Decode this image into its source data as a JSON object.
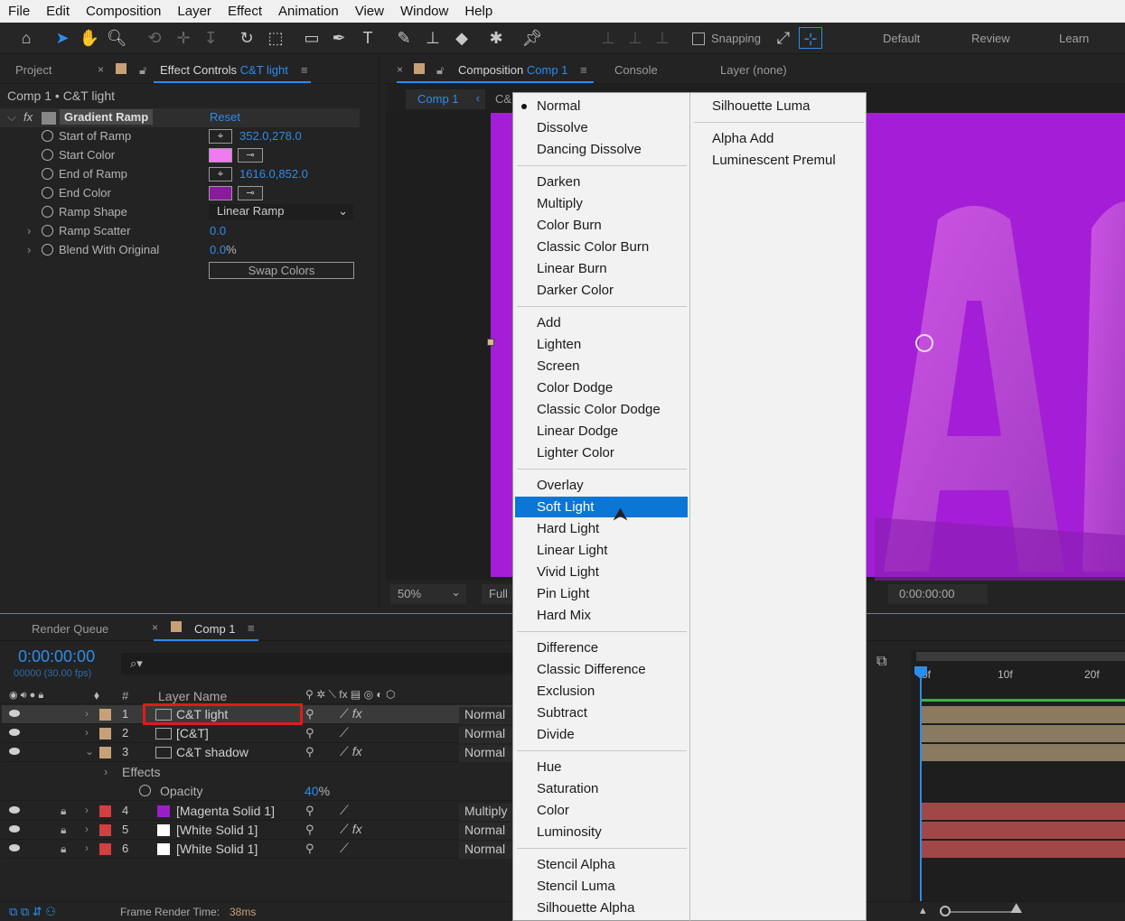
{
  "menubar": [
    "File",
    "Edit",
    "Composition",
    "Layer",
    "Effect",
    "Animation",
    "View",
    "Window",
    "Help"
  ],
  "toolbar": {
    "snapping_label": "Snapping",
    "workspaces": [
      "Default",
      "Review",
      "Learn"
    ]
  },
  "project_tab": "Project",
  "effect_controls": {
    "tab_label": "Effect Controls",
    "tab_layer": "C&T light",
    "breadcrumb": "Comp 1 • C&T light",
    "effect_name": "Gradient Ramp",
    "reset_label": "Reset",
    "properties": [
      {
        "label": "Start of Ramp",
        "value": "352.0,278.0"
      },
      {
        "label": "Start Color",
        "value": ""
      },
      {
        "label": "End of Ramp",
        "value": "1616.0,852.0"
      },
      {
        "label": "End Color",
        "value": ""
      },
      {
        "label": "Ramp Shape",
        "value": "Linear Ramp"
      },
      {
        "label": "Ramp Scatter",
        "value": "0.0"
      },
      {
        "label": "Blend With Original",
        "value": "0.0",
        "unit": "%"
      }
    ],
    "start_color": "#f07af0",
    "end_color": "#8a1a9e",
    "swap_colors_label": "Swap Colors"
  },
  "composition": {
    "tab_label": "Composition",
    "tab_comp": "Comp 1",
    "console_tab": "Console",
    "layer_tab": "Layer (none)",
    "subtab": "Comp 1",
    "subtab2": "C&",
    "zoom": "50%",
    "resolution": "Full",
    "timecode": "0:00:00:00",
    "bg_color": "#a31ed6",
    "letter": "AB"
  },
  "blend_menu": {
    "groups": [
      [
        "Normal",
        "Dissolve",
        "Dancing Dissolve"
      ],
      [
        "Darken",
        "Multiply",
        "Color Burn",
        "Classic Color Burn",
        "Linear Burn",
        "Darker Color"
      ],
      [
        "Add",
        "Lighten",
        "Screen",
        "Color Dodge",
        "Classic Color Dodge",
        "Linear Dodge",
        "Lighter Color"
      ],
      [
        "Overlay",
        "Soft Light",
        "Hard Light",
        "Linear Light",
        "Vivid Light",
        "Pin Light",
        "Hard Mix"
      ],
      [
        "Difference",
        "Classic Difference",
        "Exclusion",
        "Subtract",
        "Divide"
      ],
      [
        "Hue",
        "Saturation",
        "Color",
        "Luminosity"
      ],
      [
        "Stencil Alpha",
        "Stencil Luma",
        "Silhouette Alpha"
      ]
    ],
    "column2": [
      [
        "Silhouette Luma"
      ],
      [
        "Alpha Add",
        "Luminescent Premul"
      ]
    ],
    "checked": "Normal",
    "highlighted": "Soft Light"
  },
  "timeline": {
    "render_queue_tab": "Render Queue",
    "comp_tab": "Comp 1",
    "timecode": "0:00:00:00",
    "fps": "00000 (30.00 fps)",
    "col_hash": "#",
    "col_layer_name": "Layer Name",
    "layers": [
      {
        "num": "1",
        "name": "C&T light",
        "mode": "Normal",
        "color": "#c8a078",
        "fx": true
      },
      {
        "num": "2",
        "name": "[C&T]",
        "mode": "Normal",
        "color": "#c8a078",
        "fx": false
      },
      {
        "num": "3",
        "name": "C&T shadow",
        "mode": "Normal",
        "color": "#c8a078",
        "fx": true
      },
      {
        "num": "4",
        "name": "[Magenta Solid 1]",
        "mode": "Multiply",
        "color": "#d04040",
        "fx": false
      },
      {
        "num": "5",
        "name": "[White Solid 1]",
        "mode": "Normal",
        "color": "#d04040",
        "fx": true
      },
      {
        "num": "6",
        "name": "[White Solid 1]",
        "mode": "Normal",
        "color": "#d04040",
        "fx": false
      }
    ],
    "effects_label": "Effects",
    "opacity_label": "Opacity",
    "opacity_value": "40",
    "opacity_unit": "%",
    "ruler": [
      "0f",
      "10f",
      "20f"
    ],
    "frame_render_label": "Frame Render Time:",
    "frame_render_value": "38ms"
  }
}
